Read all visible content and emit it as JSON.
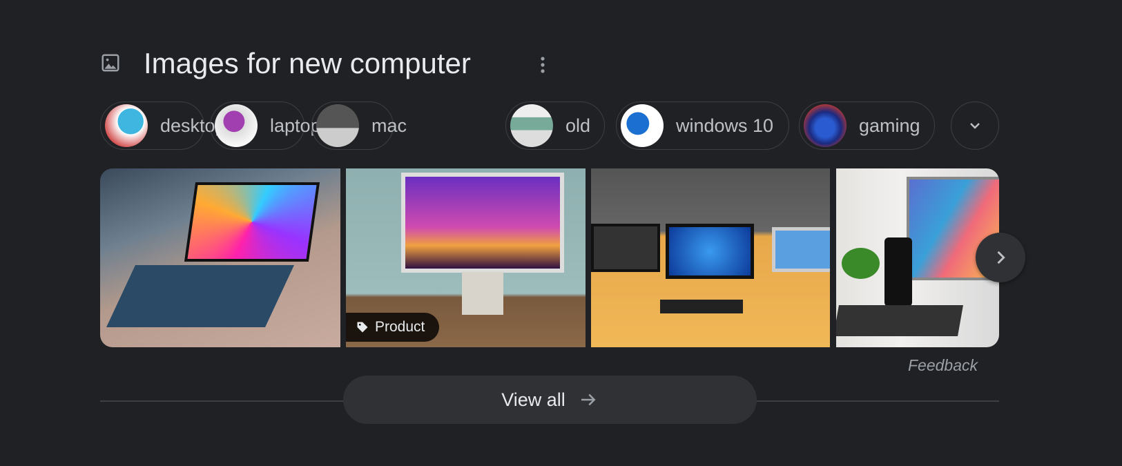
{
  "header": {
    "title": "Images for new computer",
    "icon": "image-icon",
    "menu_icon": "more-vert-icon"
  },
  "chips": [
    {
      "label": "desktop"
    },
    {
      "label": "laptop"
    },
    {
      "label": "mac"
    },
    {
      "label": "old"
    },
    {
      "label": "windows 10"
    },
    {
      "label": "gaming"
    }
  ],
  "images": [
    {
      "subject": "laptop with colorful swirl screen"
    },
    {
      "subject": "desktop monitor with city skyline",
      "badge": "Product"
    },
    {
      "subject": "laptop, windows monitor and imac on desk"
    },
    {
      "subject": "monitor with speaker, plant and keyboard"
    }
  ],
  "feedback": "Feedback",
  "view_all": "View all",
  "colors": {
    "background": "#202124",
    "chip_border": "#3c4043",
    "button": "#303134",
    "text": "#e8eaed"
  }
}
